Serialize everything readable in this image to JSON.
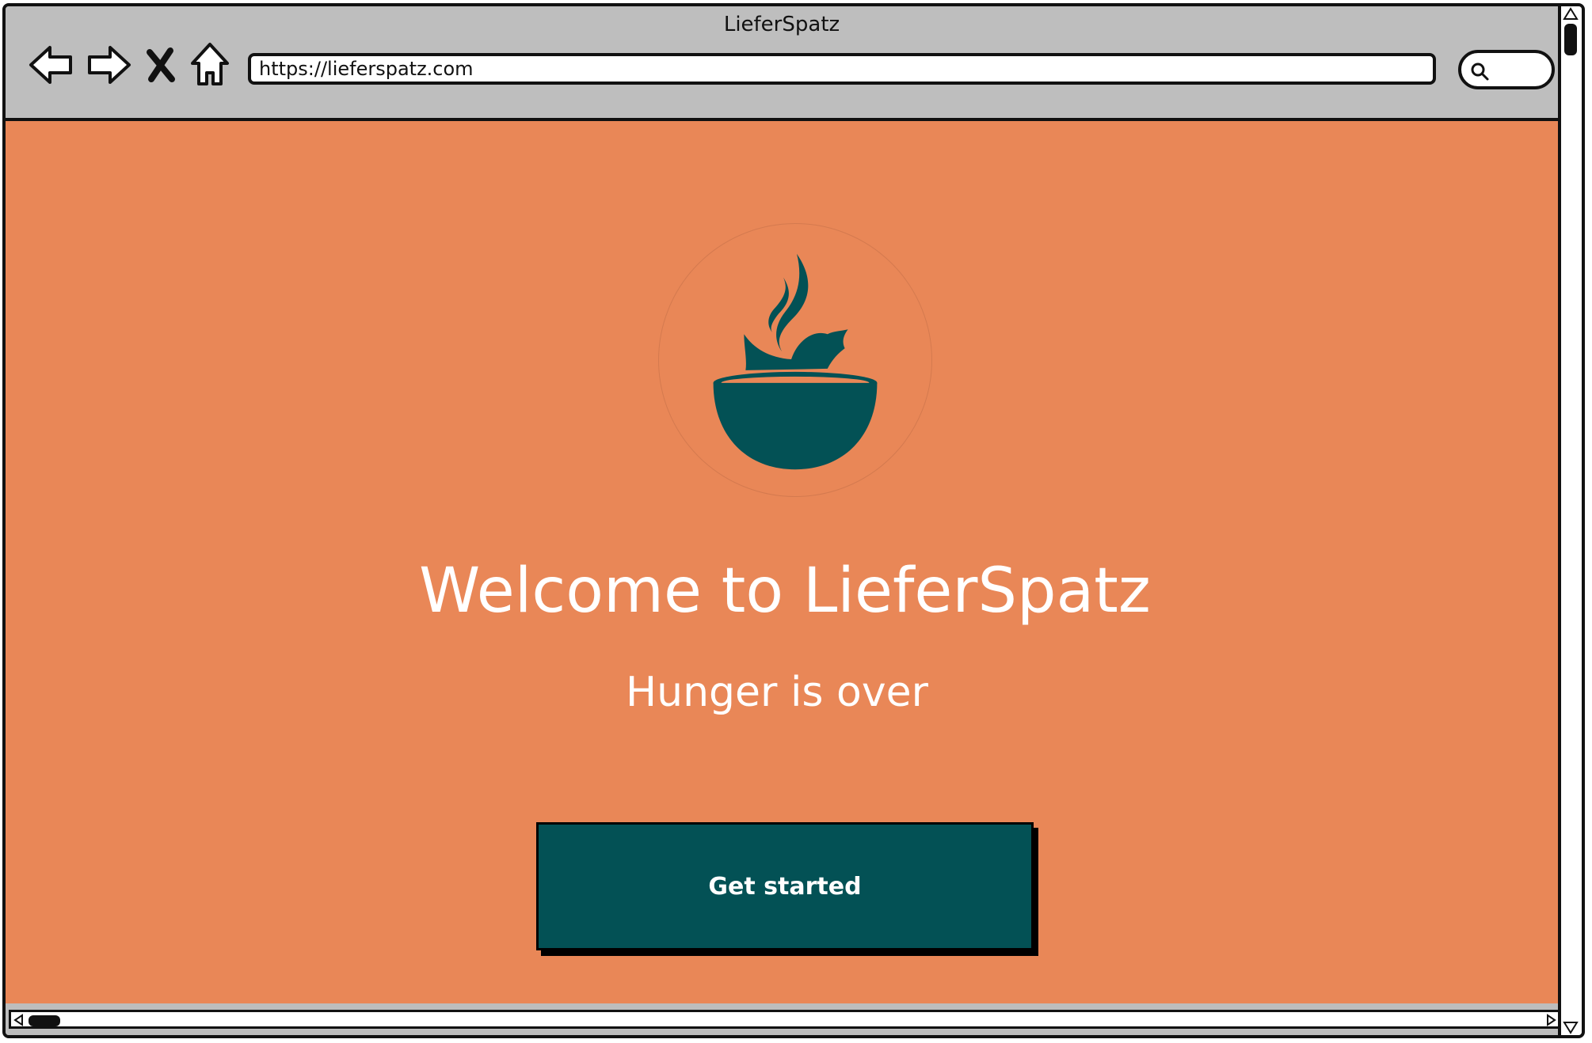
{
  "window": {
    "title": "LieferSpatz"
  },
  "toolbar": {
    "back_icon": "back-arrow-icon",
    "forward_icon": "forward-arrow-icon",
    "stop_icon": "close-icon",
    "home_icon": "home-icon",
    "url": "https://lieferspatz.com",
    "search_icon": "search-icon"
  },
  "hero": {
    "logo": "bird-in-bowl-logo",
    "heading": "Welcome to LieferSpatz",
    "subheading": "Hunger is over",
    "cta_label": "Get started"
  },
  "colors": {
    "background": "#e98757",
    "primary": "#035155",
    "text_on_primary": "#ffffff",
    "chrome": "#bdbdbd"
  }
}
